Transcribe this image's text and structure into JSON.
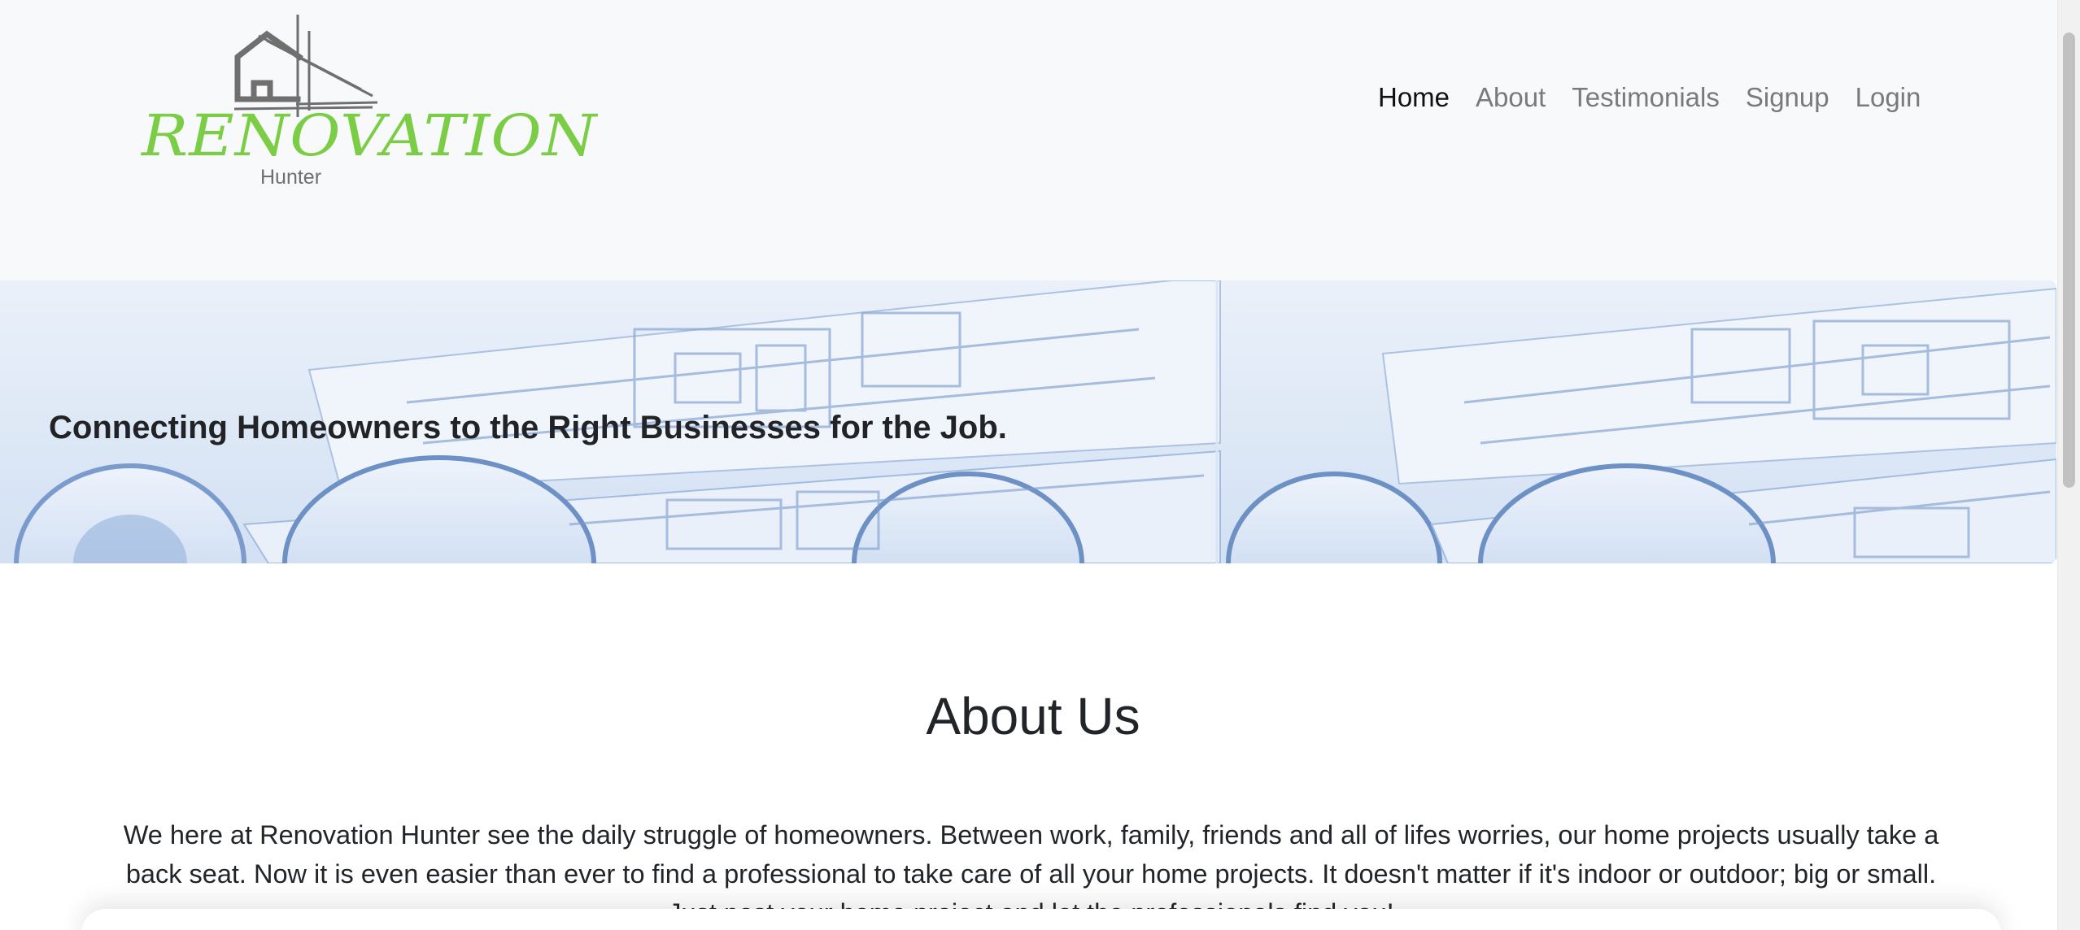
{
  "brand": {
    "logo_main": "RENOVATION",
    "logo_sub": "Hunter",
    "logo_color": "#7ccd46",
    "icon": "house-blueprint-icon"
  },
  "nav": {
    "items": [
      {
        "label": "Home",
        "active": true
      },
      {
        "label": "About",
        "active": false
      },
      {
        "label": "Testimonials",
        "active": false
      },
      {
        "label": "Signup",
        "active": false
      },
      {
        "label": "Login",
        "active": false
      }
    ]
  },
  "hero": {
    "title": "Connecting Homeowners to the Right Businesses for the Job."
  },
  "about": {
    "heading": "About Us",
    "body": "We here at Renovation Hunter see the daily struggle of homeowners. Between work, family, friends and all of lifes worries, our home projects usually take a back seat. Now it is even easier than ever to find a professional to take care of all your home projects. It doesn't matter if it's indoor or outdoor; big or small. Just post your home project and let the professionals find you!"
  }
}
